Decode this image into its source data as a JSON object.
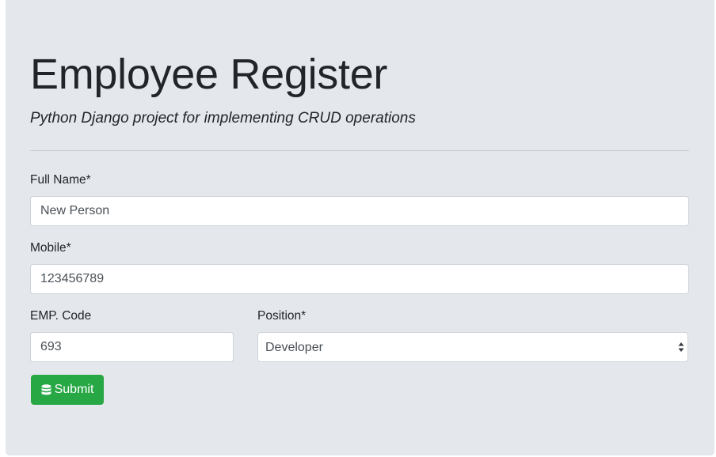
{
  "header": {
    "title": "Employee Register",
    "subtitle": "Python Django project for implementing CRUD operations"
  },
  "form": {
    "full_name": {
      "label": "Full Name*",
      "value": "New Person"
    },
    "mobile": {
      "label": "Mobile*",
      "value": "123456789"
    },
    "emp_code": {
      "label": "EMP. Code",
      "value": "693"
    },
    "position": {
      "label": "Position*",
      "selected": "Developer"
    },
    "submit": {
      "label": "Submit",
      "icon": "database-icon"
    }
  },
  "colors": {
    "background": "#e4e7eb",
    "submit_button": "#28a745"
  }
}
